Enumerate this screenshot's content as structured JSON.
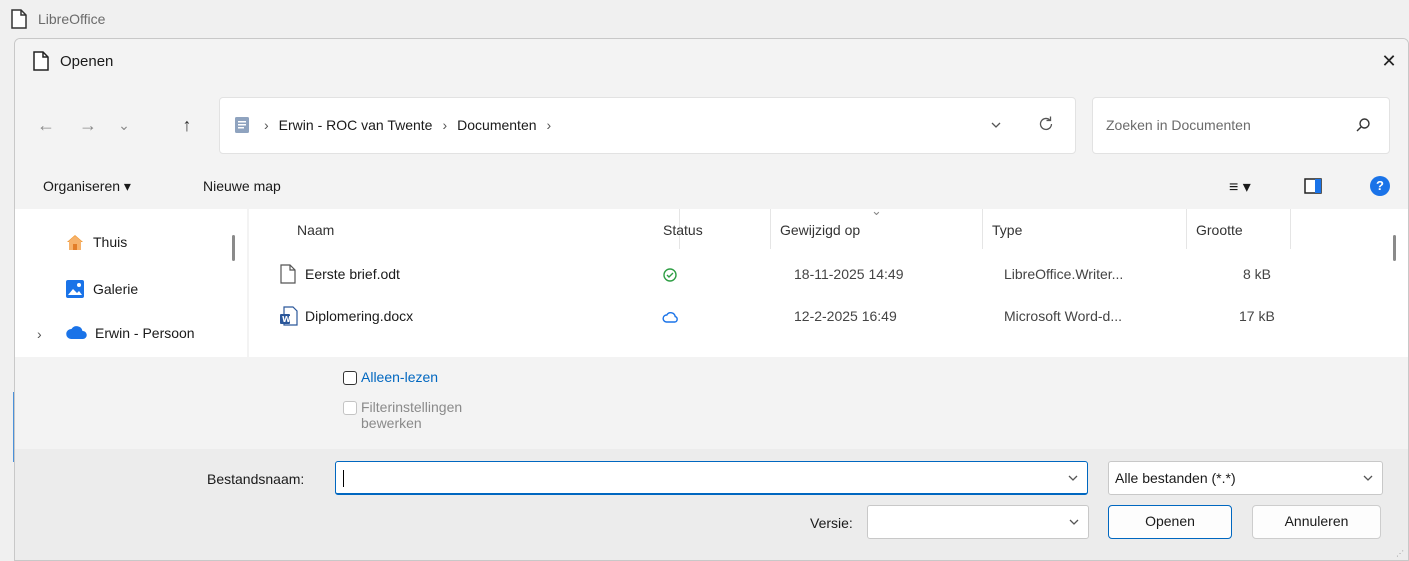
{
  "app": {
    "title": "LibreOffice",
    "icon": "document-icon"
  },
  "dialog": {
    "title": "Openen",
    "close_glyph": "✕"
  },
  "navigation": {
    "back_glyph": "←",
    "forward_glyph": "→",
    "recent_glyph": "⌄",
    "up_glyph": "↑",
    "breadcrumb": [
      "Erwin - ROC van Twente",
      "Documenten"
    ],
    "separator": "›",
    "search_placeholder": "Zoeken in Documenten"
  },
  "toolbar": {
    "organise_label": "Organiseren ▾",
    "new_folder_label": "Nieuwe map",
    "view_glyph": "≡ ▾",
    "help_glyph": "?"
  },
  "sidebar": {
    "items": [
      {
        "label": "Thuis",
        "icon": "home-icon"
      },
      {
        "label": "Galerie",
        "icon": "gallery-icon"
      },
      {
        "label": "Erwin - Persoon",
        "icon": "onedrive-cloud-icon",
        "expand": "›"
      }
    ]
  },
  "files": {
    "columns": [
      "Naam",
      "Status",
      "Gewijzigd op",
      "Type",
      "Grootte"
    ],
    "sort_indicator": "⌄",
    "rows": [
      {
        "name": "Eerste brief.odt",
        "icon": "blank-document-icon",
        "status_icon": "synced-check-icon",
        "modified": "18-11-2025 14:49",
        "type": "LibreOffice.Writer...",
        "size": "8 kB"
      },
      {
        "name": "Diplomering.docx",
        "icon": "word-document-icon",
        "status_icon": "cloud-only-icon",
        "modified": "12-2-2025 16:49",
        "type": "Microsoft Word-d...",
        "size": "17 kB"
      }
    ]
  },
  "options": {
    "readonly_label": "Alleen-lezen",
    "filter_label_line1": "Filterinstellingen",
    "filter_label_line2": "bewerken"
  },
  "footer": {
    "filename_label": "Bestandsnaam:",
    "filename_value": "",
    "filetype_value": "Alle bestanden (*.*)",
    "version_label": "Versie:",
    "version_value": "",
    "open_label": "Openen",
    "cancel_label": "Annuleren",
    "dropdown_glyph": "⌄"
  },
  "colors": {
    "accent": "#0067c0",
    "link": "#0067c0",
    "synced": "#2e9e44",
    "cloud": "#1a73e8"
  }
}
